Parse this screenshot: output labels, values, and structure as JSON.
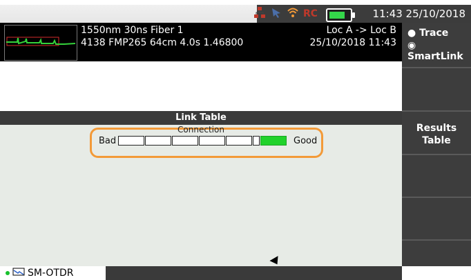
{
  "status_bar": {
    "time": "11:43 25/10/2018",
    "icons": [
      "network-icon",
      "cursor-icon",
      "wifi-icon",
      "rc-icon",
      "battery-icon"
    ]
  },
  "measurement": {
    "line1_left": "1550nm  30ns  Fiber  1",
    "line2_left": "4138 FMP265  64cm  4.0s  1.46800",
    "line1_right": "Loc A -> Loc B",
    "line2_right": "25/10/2018   11:43"
  },
  "sidebar": {
    "trace": "Trace",
    "smartlink": "SmartLink",
    "results_line1": "Results",
    "results_line2": "Table"
  },
  "link_table": {
    "title": "Link Table",
    "connection_label": "Connection",
    "bad_label": "Bad",
    "good_label": "Good",
    "quality": "Good"
  },
  "bottom": {
    "mode": "SM-OTDR"
  },
  "colors": {
    "highlight": "#f39a38",
    "good": "#21d22b",
    "bar_bg": "#3a3a3a"
  }
}
